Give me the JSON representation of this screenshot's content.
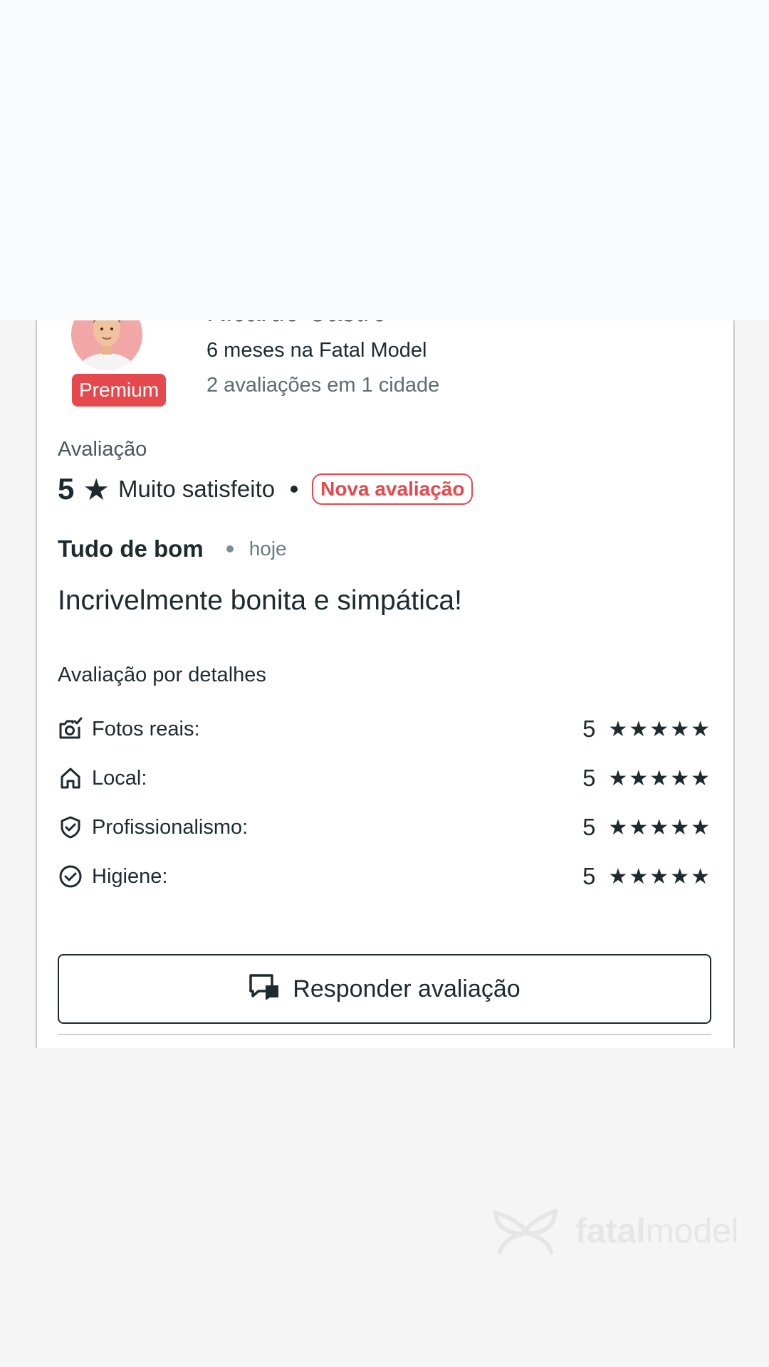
{
  "profile": {
    "name": "Ricardo Castro",
    "badge": "Premium",
    "tenure": "6 meses na Fatal Model",
    "reviews_summary": "2 avaliações em 1 cidade"
  },
  "rating": {
    "label": "Avaliação",
    "score": "5",
    "star": "★",
    "text": "Muito satisfeito",
    "new_badge": "Nova avaliação"
  },
  "review": {
    "title": "Tudo de bom",
    "date": "hoje",
    "text": "Incrivelmente bonita e simpática!"
  },
  "details": {
    "title": "Avaliação por detalhes",
    "items": [
      {
        "label": "Fotos reais:",
        "score": "5",
        "stars": "★★★★★",
        "icon": "camera-check-icon"
      },
      {
        "label": "Local:",
        "score": "5",
        "stars": "★★★★★",
        "icon": "home-icon"
      },
      {
        "label": "Profissionalismo:",
        "score": "5",
        "stars": "★★★★★",
        "icon": "shield-check-icon"
      },
      {
        "label": "Higiene:",
        "score": "5",
        "stars": "★★★★★",
        "icon": "check-circle-icon"
      }
    ]
  },
  "actions": {
    "respond_label": "Responder avaliação",
    "respond_icon": "chat-bubbles-icon"
  },
  "watermark": {
    "logo_bold": "fatal",
    "logo_light": "model"
  },
  "colors": {
    "accent": "#e5484d",
    "text": "#1f2a2e",
    "muted": "#5f6b70"
  }
}
